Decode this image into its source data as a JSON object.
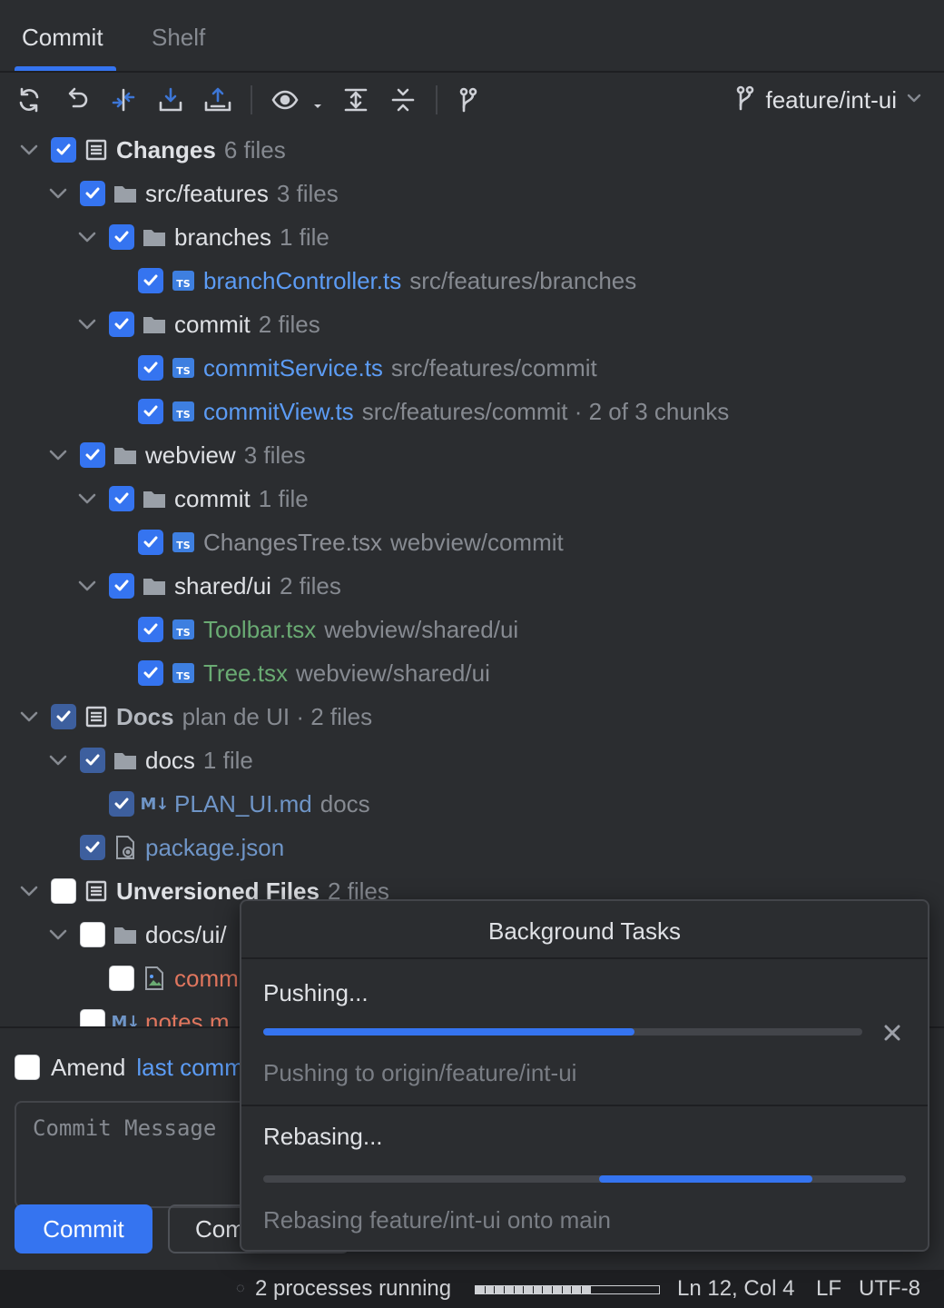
{
  "tabs": [
    {
      "label": "Commit",
      "active": true
    },
    {
      "label": "Shelf",
      "active": false
    }
  ],
  "toolbar": {
    "icons": [
      "refresh-icon",
      "rollback-icon",
      "diff-icon",
      "update-icon",
      "push-icon",
      "eye-icon",
      "expand-all-icon",
      "collapse-all-icon",
      "branch-icon"
    ],
    "branch": "feature/int-ui"
  },
  "tree": {
    "changes": {
      "name": "Changes",
      "meta": "6 files"
    },
    "src_features": {
      "name": "src/features",
      "meta": "3 files"
    },
    "branches": {
      "name": "branches",
      "meta": "1 file"
    },
    "branchController": {
      "name": "branchController.ts",
      "meta": "src/features/branches"
    },
    "commit1": {
      "name": "commit",
      "meta": "2 files"
    },
    "commitService": {
      "name": "commitService.ts",
      "meta": "src/features/commit"
    },
    "commitView": {
      "name": "commitView.ts",
      "meta": "src/features/commit · 2 of 3 chunks"
    },
    "webview": {
      "name": "webview",
      "meta": "3 files"
    },
    "commit2": {
      "name": "commit",
      "meta": "1 file"
    },
    "changesTree": {
      "name": "ChangesTree.tsx",
      "meta": "webview/commit"
    },
    "shared_ui": {
      "name": "shared/ui",
      "meta": "2 files"
    },
    "toolbarTsx": {
      "name": "Toolbar.tsx",
      "meta": "webview/shared/ui"
    },
    "treeTsx": {
      "name": "Tree.tsx",
      "meta": "webview/shared/ui"
    },
    "docs_list": {
      "name": "Docs",
      "meta": "plan de UI · 2 files"
    },
    "docs_folder": {
      "name": "docs",
      "meta": "1 file"
    },
    "plan_md": {
      "name": "PLAN_UI.md",
      "meta": "docs"
    },
    "package_json": {
      "name": "package.json",
      "meta": ""
    },
    "unversioned": {
      "name": "Unversioned Files",
      "meta": "2 files"
    },
    "docs_ui": {
      "name": "docs/ui/",
      "meta": ""
    },
    "comm_file": {
      "name": "comm",
      "meta": ""
    },
    "notes_md": {
      "name": "notes m",
      "meta": ""
    }
  },
  "commit_area": {
    "amend_label": "Amend",
    "amend_link": "last comm",
    "message_placeholder": "Commit Message",
    "commit_button": "Commit",
    "secondary_button": "Com"
  },
  "background_tasks": {
    "title": "Background Tasks",
    "tasks": [
      {
        "title": "Pushing...",
        "description": "Pushing to origin/feature/int-ui",
        "progress": 0.62
      },
      {
        "title": "Rebasing...",
        "description": "Rebasing feature/int-ui onto main",
        "indeterminate": true
      }
    ]
  },
  "statusbar": {
    "processes": "2 processes running",
    "position": "Ln 12, Col 4",
    "line_ending": "LF",
    "encoding": "UTF-8"
  },
  "colors": {
    "accent": "#3574f0",
    "background": "#2b2d30",
    "modified_file": "#5c9cf5",
    "added_file": "#6aab73",
    "unversioned_file": "#e0765e"
  }
}
